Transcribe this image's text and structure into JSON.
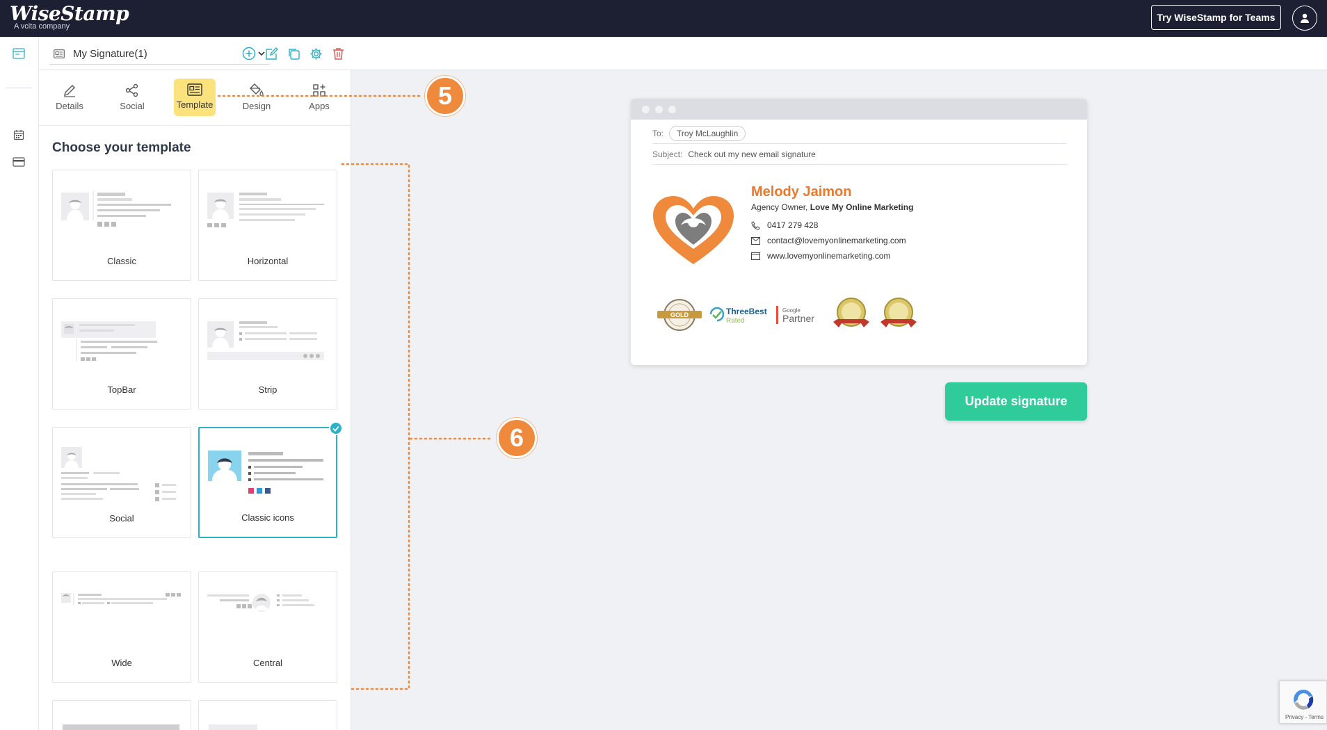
{
  "brand": {
    "logo": "WiseStamp",
    "tagline": "A vcita company"
  },
  "topbar": {
    "teams_button": "Try WiseStamp for Teams",
    "user_icon": "user-icon"
  },
  "toolbar": {
    "signature_name": "My Signature(1)",
    "icons": [
      "add-icon",
      "edit-icon",
      "duplicate-icon",
      "settings-icon",
      "delete-icon"
    ]
  },
  "tabs": [
    {
      "label": "Details",
      "icon": "pencil-icon"
    },
    {
      "label": "Social",
      "icon": "share-icon"
    },
    {
      "label": "Template",
      "icon": "template-icon",
      "active": true
    },
    {
      "label": "Design",
      "icon": "paint-bucket-icon"
    },
    {
      "label": "Apps",
      "icon": "apps-icon"
    }
  ],
  "panel": {
    "title": "Choose your template",
    "templates": [
      {
        "label": "Classic"
      },
      {
        "label": "Horizontal"
      },
      {
        "label": "TopBar"
      },
      {
        "label": "Strip"
      },
      {
        "label": "Social"
      },
      {
        "label": "Classic icons",
        "selected": true
      },
      {
        "label": "Wide"
      },
      {
        "label": "Central"
      }
    ]
  },
  "annotations": {
    "step5": "5",
    "step6": "6",
    "color": "#ef8a3c"
  },
  "email": {
    "to_label": "To:",
    "to_value": "Troy McLaughlin",
    "subject_label": "Subject:",
    "subject_value": "Check out my new email signature",
    "signature": {
      "name": "Melody Jaimon",
      "title_prefix": "Agency Owner",
      "company": "Love My Online Marketing",
      "phone": "0417 279 428",
      "email": "contact@lovemyonlinemarketing.com",
      "website": "www.lovemyonlinemarketing.com",
      "name_color": "#e8792d",
      "badges": {
        "threebest_a": "ThreeBest",
        "threebest_b": "Rated",
        "google_a": "Google",
        "google_b": "Partner",
        "gold": "GOLD"
      }
    }
  },
  "update_button": "Update signature",
  "recaptcha": "Privacy - Terms",
  "colors": {
    "navbar": "#1d2032",
    "accent": "#2cb1c8",
    "update": "#2fcb98",
    "tab_active": "#fbe27d"
  }
}
